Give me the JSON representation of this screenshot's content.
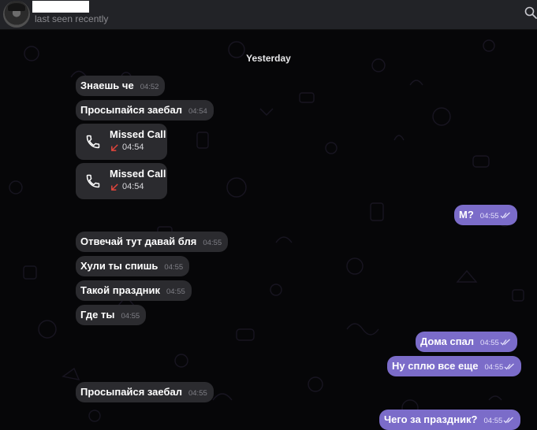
{
  "header": {
    "status": "last seen recently"
  },
  "chat": {
    "date_label": "Yesterday",
    "messages": [
      {
        "text": "Знаешь че",
        "time": "04:52"
      },
      {
        "text": "Просыпайся заебал",
        "time": "04:54"
      },
      {
        "title": "Missed Call",
        "time": "04:54"
      },
      {
        "title": "Missed Call",
        "time": "04:54"
      },
      {
        "text": "М?",
        "time": "04:55"
      },
      {
        "text": "Отвечай тут давай бля",
        "time": "04:55"
      },
      {
        "text": "Хули ты спишь",
        "time": "04:55"
      },
      {
        "text": "Такой праздник",
        "time": "04:55"
      },
      {
        "text": "Где ты",
        "time": "04:55"
      },
      {
        "text": "Дома спал",
        "time": "04:55"
      },
      {
        "text": "Ну сплю все еще",
        "time": "04:55"
      },
      {
        "text": "Просыпайся заебал",
        "time": "04:55"
      },
      {
        "text": "Чего за праздник?",
        "time": "04:55"
      }
    ]
  },
  "colors": {
    "incoming_bubble": "#2b2b2f",
    "outgoing_bubble": "#7b6cc9",
    "missed_call_arrow": "#e2453c",
    "header": "#222327"
  }
}
